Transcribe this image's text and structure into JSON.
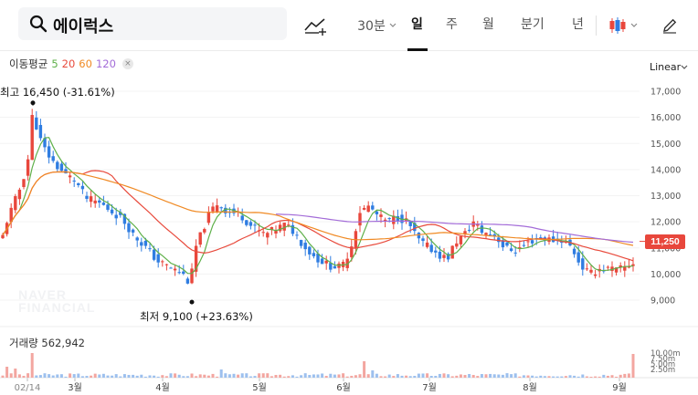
{
  "search": {
    "query": "에이럭스"
  },
  "toolbar": {
    "interval": "30분",
    "tabs": [
      {
        "label": "일",
        "active": true
      },
      {
        "label": "주",
        "active": false
      },
      {
        "label": "월",
        "active": false
      },
      {
        "label": "분기",
        "active": false
      },
      {
        "label": "년",
        "active": false
      }
    ]
  },
  "legend": {
    "ma_title": "이동평균",
    "ma_periods": [
      {
        "label": "5",
        "color": "#5fb04a"
      },
      {
        "label": "20",
        "color": "#e84a3c"
      },
      {
        "label": "60",
        "color": "#f08a24"
      },
      {
        "label": "120",
        "color": "#a36cd8"
      }
    ],
    "volume_label": "거래량 562,942"
  },
  "scale_mode": "Linear",
  "watermark": [
    "NAVER",
    "FINANCIAL"
  ],
  "chart_data": {
    "type": "candlestick",
    "y_ticks": [
      "17,000",
      "16,000",
      "15,000",
      "14,000",
      "13,000",
      "12,000",
      "11,000",
      "10,000",
      "9,000"
    ],
    "ylim": [
      8500,
      17600
    ],
    "x_labels": [
      "02/14",
      "3월",
      "4월",
      "5월",
      "6월",
      "7월",
      "8월",
      "9월"
    ],
    "current_price": "11,250",
    "high_label": "최고 16,450 (-31.61%)",
    "low_label": "최저 9,100 (+23.63%)",
    "volume_ticks": [
      "10.00m",
      "7.50m",
      "5.00m",
      "2.50m"
    ],
    "colors": {
      "up": "#e8473c",
      "down": "#2f7de1",
      "ma5": "#5fb04a",
      "ma20": "#e84a3c",
      "ma60": "#f08a24",
      "ma120": "#a36cd8"
    }
  }
}
